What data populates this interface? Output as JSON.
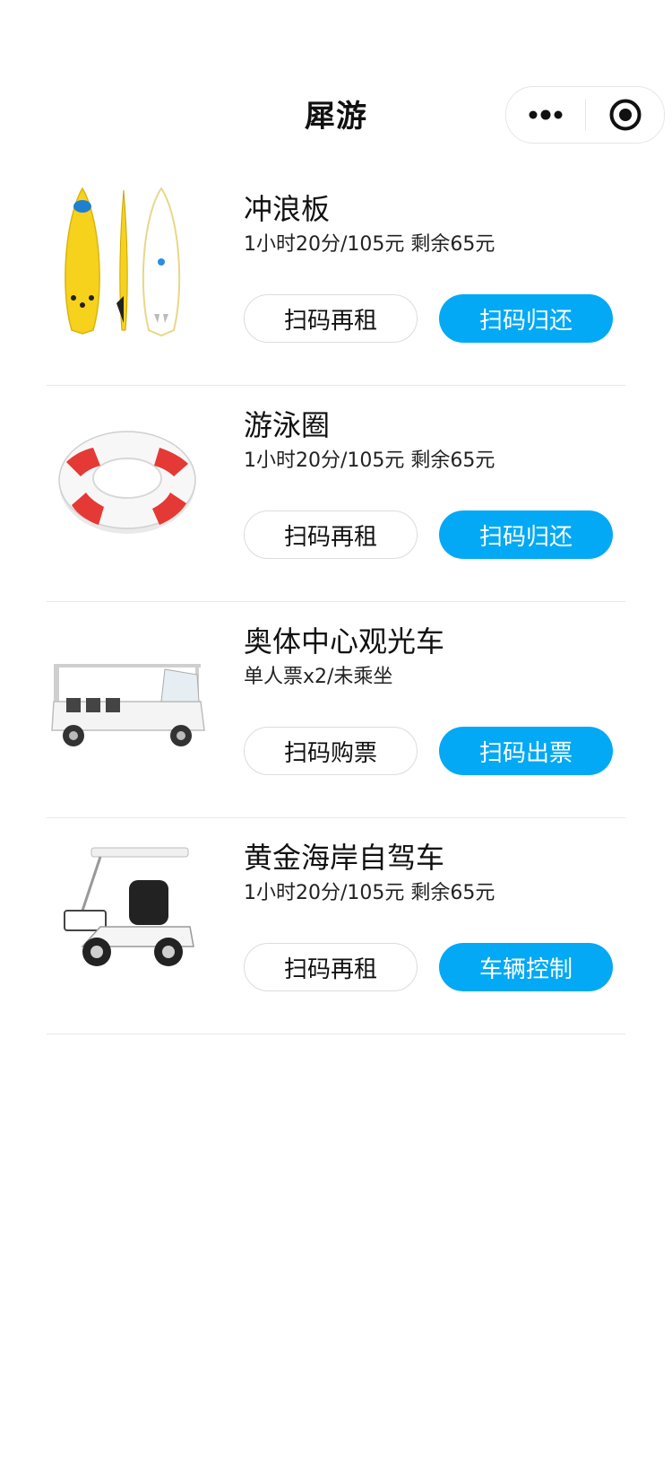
{
  "app": {
    "title": "犀游"
  },
  "capsule": {
    "more_icon": "more-dots-icon",
    "close_icon": "target-circle-icon"
  },
  "colors": {
    "primary": "#03a9f4",
    "divider": "#e8e8e8"
  },
  "items": [
    {
      "name": "冲浪板",
      "desc": "1小时20分/105元 剩余65元",
      "secondary_label": "扫码再租",
      "primary_label": "扫码归还",
      "image": "surfboard-image"
    },
    {
      "name": "游泳圈",
      "desc": "1小时20分/105元 剩余65元",
      "secondary_label": "扫码再租",
      "primary_label": "扫码归还",
      "image": "swim-ring-image"
    },
    {
      "name": "奥体中心观光车",
      "desc": "单人票x2/未乘坐",
      "secondary_label": "扫码购票",
      "primary_label": "扫码出票",
      "image": "sightseeing-cart-image"
    },
    {
      "name": "黄金海岸自驾车",
      "desc": "1小时20分/105元 剩余65元",
      "secondary_label": "扫码再租",
      "primary_label": "车辆控制",
      "image": "mobility-scooter-image"
    }
  ]
}
